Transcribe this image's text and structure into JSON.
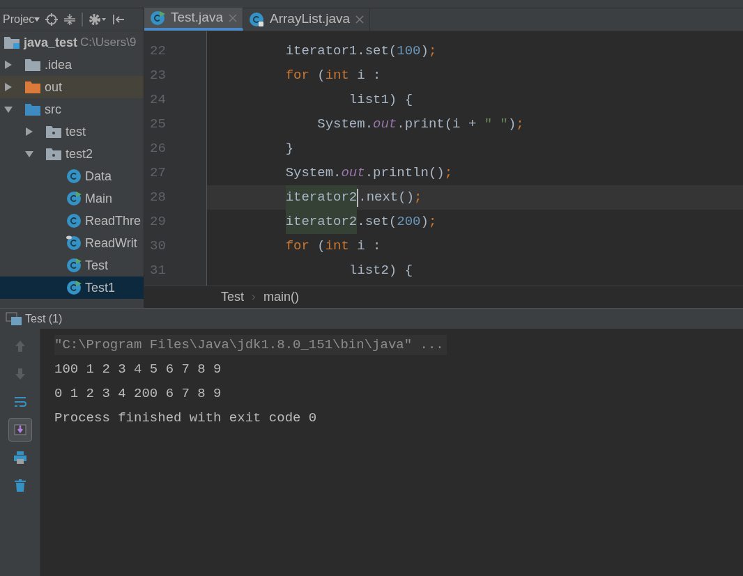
{
  "project_toolbar": {
    "title": "Projec"
  },
  "editor_tabs": [
    {
      "label": "Test.java",
      "kind": "runnable",
      "selected": true
    },
    {
      "label": "ArrayList.java",
      "kind": "locked",
      "selected": false
    }
  ],
  "project_tree": [
    {
      "label": "java_test",
      "hint": "C:\\Users\\9",
      "kind": "project",
      "selected": false,
      "children": [
        {
          "label": ".idea",
          "kind": "folder",
          "expanded": false,
          "selected": false
        },
        {
          "label": "out",
          "kind": "excluded",
          "expanded": false,
          "selected": false
        },
        {
          "label": "src",
          "kind": "source",
          "expanded": true,
          "selected": false,
          "children": [
            {
              "label": "test",
              "kind": "package",
              "expanded": false,
              "selected": false
            },
            {
              "label": "test2",
              "kind": "package",
              "expanded": true,
              "selected": false,
              "children": [
                {
                  "label": "Data",
                  "kind": "class",
                  "selected": false
                },
                {
                  "label": "Main",
                  "kind": "runnable",
                  "selected": false
                },
                {
                  "label": "ReadThre",
                  "kind": "class",
                  "selected": false
                },
                {
                  "label": "ReadWrit",
                  "kind": "modified",
                  "selected": false
                },
                {
                  "label": "Test",
                  "kind": "runnable",
                  "selected": false
                },
                {
                  "label": "Test1",
                  "kind": "runnable",
                  "selected": true
                }
              ]
            }
          ]
        }
      ]
    }
  ],
  "code": {
    "lines": [
      {
        "number": "22",
        "tokens": [
          {
            "text": "         iterator1.set(",
            "kind": "plain"
          },
          {
            "text": "100",
            "kind": "number"
          },
          {
            "text": ")",
            "kind": "plain"
          },
          {
            "text": ";",
            "kind": "keyword"
          }
        ]
      },
      {
        "number": "23",
        "tokens": [
          {
            "text": "         for",
            "kind": "keyword"
          },
          {
            "text": " (",
            "kind": "plain"
          },
          {
            "text": "int",
            "kind": "keyword"
          },
          {
            "text": " i :",
            "kind": "plain"
          }
        ]
      },
      {
        "number": "24",
        "tokens": [
          {
            "text": "                 list1) {",
            "kind": "plain"
          }
        ]
      },
      {
        "number": "25",
        "tokens": [
          {
            "text": "             System.",
            "kind": "plain"
          },
          {
            "text": "out",
            "kind": "field"
          },
          {
            "text": ".print(i + ",
            "kind": "plain"
          },
          {
            "text": "\" \"",
            "kind": "string"
          },
          {
            "text": ")",
            "kind": "plain"
          },
          {
            "text": ";",
            "kind": "keyword"
          }
        ]
      },
      {
        "number": "26",
        "tokens": [
          {
            "text": "         }",
            "kind": "plain"
          }
        ]
      },
      {
        "number": "27",
        "tokens": [
          {
            "text": "         System.",
            "kind": "plain"
          },
          {
            "text": "out",
            "kind": "field"
          },
          {
            "text": ".println()",
            "kind": "plain"
          },
          {
            "text": ";",
            "kind": "keyword"
          }
        ]
      },
      {
        "number": "28",
        "tokens": [
          {
            "text": "         iterator2",
            "kind": "usage",
            "caret": true
          },
          {
            "text": ".next()",
            "kind": "plain"
          },
          {
            "text": ";",
            "kind": "keyword"
          }
        ]
      },
      {
        "number": "29",
        "tokens": [
          {
            "text": "         iterator2",
            "kind": "usage"
          },
          {
            "text": ".set(",
            "kind": "plain"
          },
          {
            "text": "200",
            "kind": "number"
          },
          {
            "text": ")",
            "kind": "plain"
          },
          {
            "text": ";",
            "kind": "keyword"
          }
        ]
      },
      {
        "number": "30",
        "tokens": [
          {
            "text": "         for",
            "kind": "keyword"
          },
          {
            "text": " (",
            "kind": "plain"
          },
          {
            "text": "int",
            "kind": "keyword"
          },
          {
            "text": " i :",
            "kind": "plain"
          }
        ]
      },
      {
        "number": "31",
        "tokens": [
          {
            "text": "                 list2) {",
            "kind": "plain"
          }
        ]
      }
    ]
  },
  "breadcrumb": [
    "Test",
    "main()"
  ],
  "run_panel": {
    "tab": "Test (1)",
    "tools": [
      {
        "kind": "up",
        "disabled": true,
        "selected": false
      },
      {
        "kind": "down",
        "disabled": true,
        "selected": false
      },
      {
        "kind": "wrap",
        "disabled": false,
        "selected": false
      },
      {
        "kind": "scroll",
        "disabled": false,
        "selected": true
      },
      {
        "kind": "print",
        "disabled": false,
        "selected": false
      },
      {
        "kind": "trash",
        "disabled": false,
        "selected": false
      }
    ],
    "console": [
      {
        "text": "\"C:\\Program Files\\Java\\jdk1.8.0_151\\bin\\java\" ...",
        "kind": "command"
      },
      {
        "text": "100 1 2 3 4 5 6 7 8 9",
        "kind": "output"
      },
      {
        "text": "0 1 2 3 4 200 6 7 8 9",
        "kind": "output"
      },
      {
        "text": "Process finished with exit code 0",
        "kind": "output"
      }
    ]
  }
}
